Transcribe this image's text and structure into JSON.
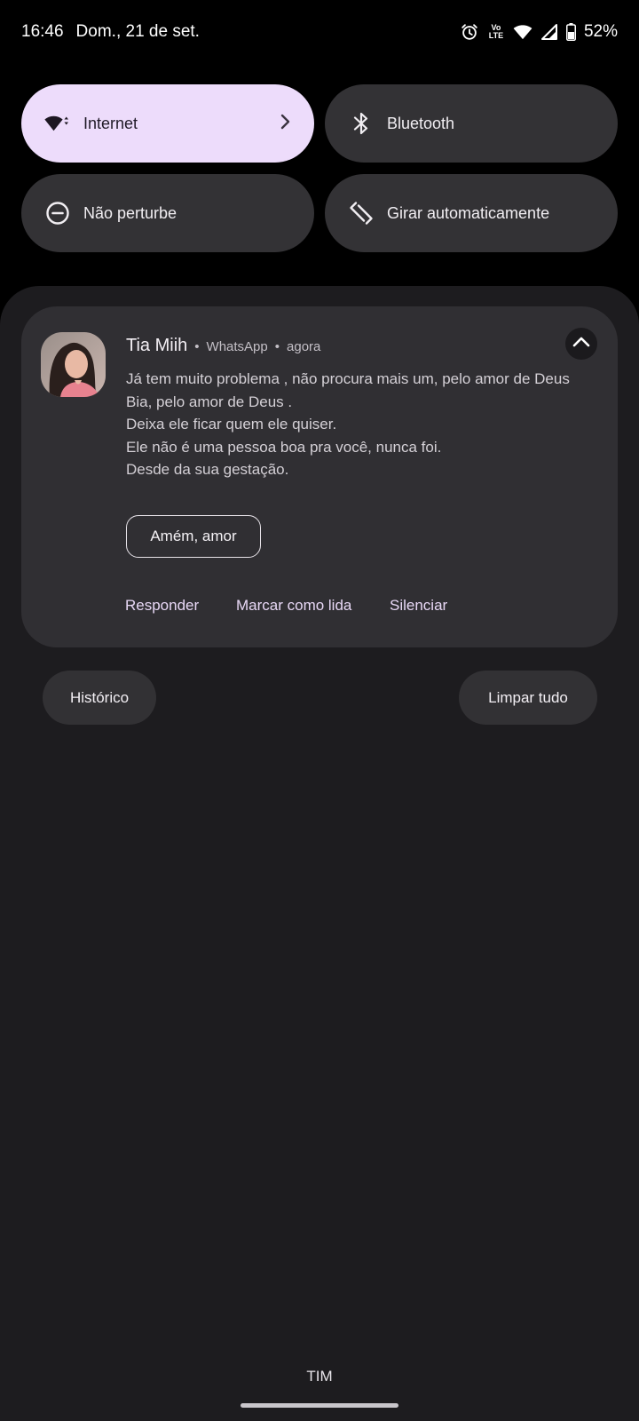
{
  "status_bar": {
    "time": "16:46",
    "date": "Dom., 21 de set.",
    "volte_top": "Vo",
    "volte_bottom": "LTE",
    "battery": "52%",
    "icons": [
      "alarm-icon",
      "volte-icon",
      "wifi-icon",
      "signal-icon",
      "battery-icon"
    ]
  },
  "quick_tiles": [
    {
      "label": "Internet",
      "icon": "wifi-icon",
      "active": true
    },
    {
      "label": "Bluetooth",
      "icon": "bluetooth-icon",
      "active": false
    },
    {
      "label": "Não perturbe",
      "icon": "do-not-disturb-icon",
      "active": false
    },
    {
      "label": "Girar automaticamente",
      "icon": "auto-rotate-icon",
      "active": false
    }
  ],
  "notification": {
    "sender": "Tia Miih",
    "app": "WhatsApp",
    "time": "agora",
    "separator": "•",
    "message_lines": [
      "Já tem muito problema , não procura mais um, pelo amor de Deus",
      "Bia, pelo amor de Deus .",
      "Deixa ele ficar quem ele quiser.",
      "Ele não é uma pessoa boa pra você, nunca foi.",
      "Desde da sua gestação."
    ],
    "smart_reply": "Amém, amor",
    "actions": [
      "Responder",
      "Marcar como lida",
      "Silenciar"
    ]
  },
  "footer_buttons": {
    "history": "Histórico",
    "clear_all": "Limpar tudo"
  },
  "carrier": "TIM",
  "colors": {
    "active_tile": "#eddcfb",
    "tile": "#333235",
    "sheet": "#1d1c1f",
    "card": "#302f33",
    "action_text": "#e8d8f6"
  }
}
